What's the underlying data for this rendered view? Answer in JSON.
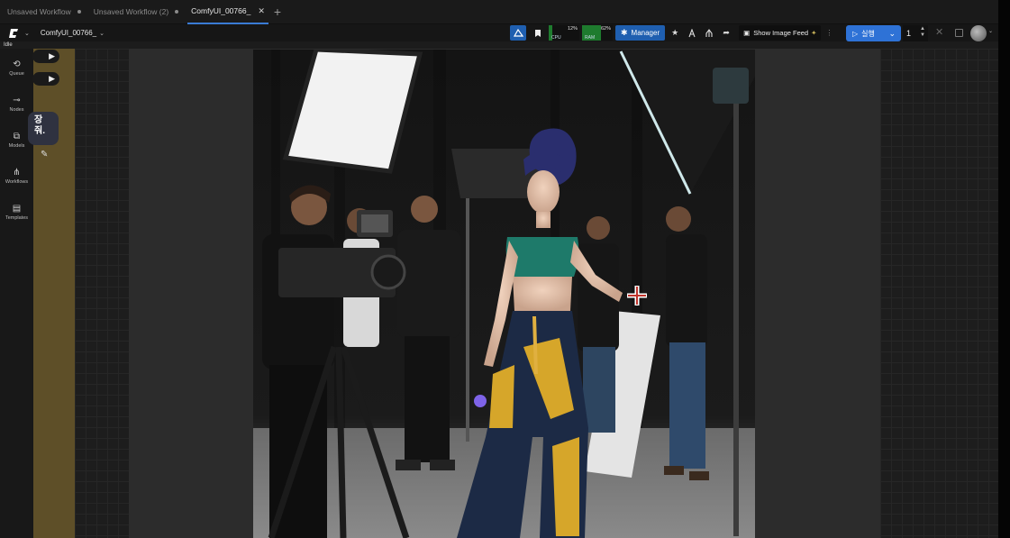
{
  "tabs": [
    {
      "label": "Unsaved Workflow",
      "active": false
    },
    {
      "label": "Unsaved Workflow (2)",
      "active": false
    },
    {
      "label": "ComfyUI_00766_",
      "active": true
    }
  ],
  "toolbar": {
    "workflow_name": "ComfyUI_00766_",
    "cpu": {
      "label": "CPU",
      "percent_text": "12%",
      "percent": 12
    },
    "ram": {
      "label": "RAM",
      "percent_text": "62%",
      "percent": 62
    },
    "manager_label": "Manager",
    "image_feed_label": "Show Image Feed",
    "run_label": "실행",
    "queue_count": "1"
  },
  "status": "Idle",
  "sidebar": {
    "items": [
      {
        "label": "Queue",
        "icon": "history-icon"
      },
      {
        "label": "Nodes",
        "icon": "nodes-icon"
      },
      {
        "label": "Models",
        "icon": "models-icon"
      },
      {
        "label": "Workflows",
        "icon": "workflows-icon"
      },
      {
        "label": "Templates",
        "icon": "templates-icon"
      }
    ]
  },
  "canvas": {
    "partial_text_line1": "장",
    "partial_text_line2": "줘."
  },
  "colors": {
    "accent_blue": "#1f5fb0",
    "run_blue": "#2e72d6",
    "sidebar_bg": "#181818",
    "node_gold": "#5e4f28",
    "panel_bg": "#2c2c2c"
  }
}
